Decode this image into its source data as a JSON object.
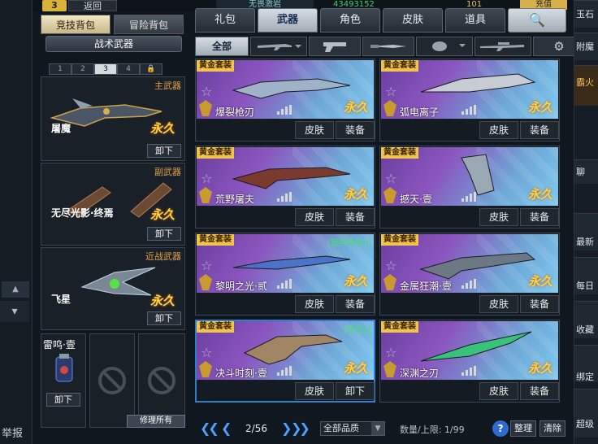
{
  "top": {
    "level": "3",
    "back_label": "返回",
    "player_name": "无畏激岩",
    "currency_a": "43493152",
    "currency_b": "101",
    "right_button": "充值"
  },
  "left_panel": {
    "bag_tabs": [
      "竞技背包",
      "冒险背包"
    ],
    "category_title": "战术武器",
    "loadout_tabs": [
      "1",
      "2",
      "3",
      "4"
    ],
    "active_loadout": "3",
    "slots": [
      {
        "type": "主武器",
        "name": "屠魔",
        "permanence": "永久",
        "action": "卸下"
      },
      {
        "type": "副武器",
        "name": "无尽光影·终焉",
        "permanence": "永久",
        "action": "卸下"
      },
      {
        "type": "近战武器",
        "name": "飞星",
        "permanence": "永久",
        "action": "卸下"
      }
    ],
    "throwable": {
      "name": "雷鸣·壹",
      "action": "卸下"
    },
    "repair_all": "修理所有"
  },
  "right_panel": {
    "main_tabs": [
      "礼包",
      "武器",
      "角色",
      "皮肤",
      "道具"
    ],
    "active_tab": "武器",
    "filter_all": "全部",
    "filters": [
      "rifle-filter",
      "pistol-filter",
      "knife-filter",
      "grenade-filter",
      "sniper-filter"
    ],
    "items": [
      {
        "tag": "黄金套装",
        "name": "爆裂枪刃",
        "perm": "永久",
        "skin": "皮肤",
        "equip": "装备",
        "bag": ""
      },
      {
        "tag": "黄金套装",
        "name": "弧电离子",
        "perm": "永久",
        "skin": "皮肤",
        "equip": "装备",
        "bag": ""
      },
      {
        "tag": "黄金套装",
        "name": "荒野屠夫",
        "perm": "永久",
        "skin": "皮肤",
        "equip": "装备",
        "bag": ""
      },
      {
        "tag": "黄金套装",
        "name": "撼天·壹",
        "perm": "永久",
        "skin": "皮肤",
        "equip": "装备",
        "bag": ""
      },
      {
        "tag": "黄金套装",
        "name": "黎明之光·贰",
        "perm": "永久",
        "skin": "皮肤",
        "equip": "装备",
        "bag": "[冒险背包1]"
      },
      {
        "tag": "黄金套装",
        "name": "金属狂潮·壹",
        "perm": "永久",
        "skin": "皮肤",
        "equip": "装备",
        "bag": ""
      },
      {
        "tag": "黄金套装",
        "name": "决斗时刻·壹",
        "perm": "永久",
        "skin": "皮肤",
        "equip": "卸下",
        "bag": "[背包2]"
      },
      {
        "tag": "黄金套装",
        "name": "深渊之刃",
        "perm": "永久",
        "skin": "皮肤",
        "equip": "装备",
        "bag": ""
      }
    ],
    "pager": {
      "page": "2/56",
      "quality": "全部品质",
      "limit": "数量/上限: 1/99",
      "sort": "整理",
      "clear": "清除"
    }
  },
  "left_strip": {
    "report": "举报"
  },
  "right_strip": {
    "items": [
      "玉石",
      "附魔",
      "霸火",
      "聊",
      "最新",
      "每日",
      "收藏",
      "绑定",
      "超级"
    ]
  },
  "colors": {
    "gold": "#f2c44a",
    "permanent": "#ffd24a",
    "accent_blue": "#4aa3ff",
    "bag_green": "#44e46a"
  }
}
